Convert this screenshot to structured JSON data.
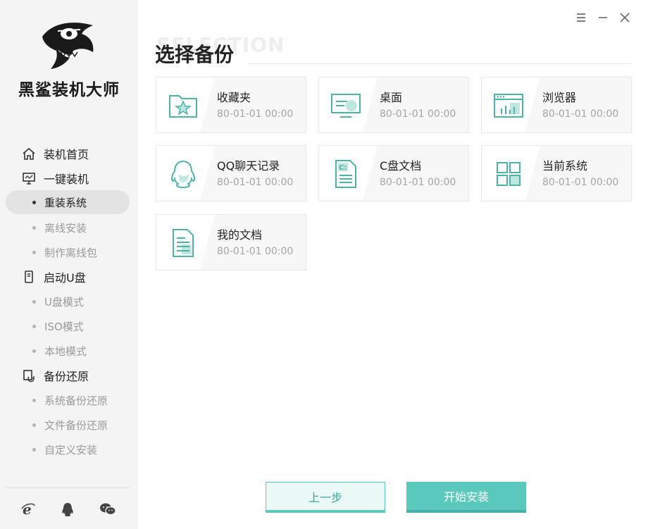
{
  "app": {
    "brand": "黑鲨装机大师"
  },
  "header": {
    "ghost_text": "SELECTION",
    "title": "选择备份"
  },
  "sidebar": {
    "groups": [
      {
        "label": "装机首页",
        "icon": "home-icon"
      },
      {
        "label": "一键装机",
        "icon": "monitor-icon"
      },
      {
        "label": "启动U盘",
        "icon": "usb-icon"
      },
      {
        "label": "备份还原",
        "icon": "backup-icon"
      }
    ],
    "subs": [
      {
        "label": "重装系统",
        "active": true
      },
      {
        "label": "离线安装"
      },
      {
        "label": "制作离线包"
      },
      {
        "label": "U盘模式"
      },
      {
        "label": "ISO模式"
      },
      {
        "label": "本地模式"
      },
      {
        "label": "系统备份还原"
      },
      {
        "label": "文件备份还原"
      },
      {
        "label": "自定义安装"
      }
    ],
    "bottom_icons": [
      "ie-icon",
      "qq-icon",
      "wechat-icon"
    ]
  },
  "cards": [
    {
      "name": "收藏夹",
      "date": "80-01-01 00:00",
      "icon": "favorites-folder-icon"
    },
    {
      "name": "桌面",
      "date": "80-01-01 00:00",
      "icon": "desktop-icon"
    },
    {
      "name": "浏览器",
      "date": "80-01-01 00:00",
      "icon": "browser-icon"
    },
    {
      "name": "QQ聊天记录",
      "date": "80-01-01 00:00",
      "icon": "qq-icon"
    },
    {
      "name": "C盘文档",
      "date": "80-01-01 00:00",
      "icon": "c-drive-doc-icon"
    },
    {
      "name": "当前系统",
      "date": "80-01-01 00:00",
      "icon": "system-grid-icon"
    },
    {
      "name": "我的文档",
      "date": "80-01-01 00:00",
      "icon": "document-icon"
    }
  ],
  "buttons": {
    "prev": "上一步",
    "start": "开始安装"
  },
  "colors": {
    "accent": "#5bc8bc",
    "sidebar_bg": "#f4f4f4",
    "active_bg": "#e3e3e3"
  }
}
